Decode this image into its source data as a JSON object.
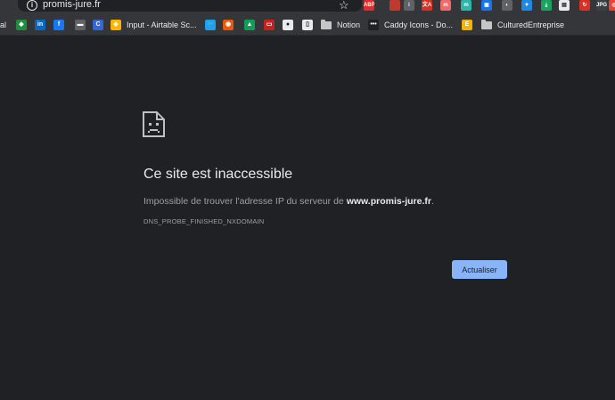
{
  "toolbar": {
    "url": "promis-jure.fr",
    "info_glyph": "i",
    "star_glyph": "☆",
    "extensions": [
      {
        "name": "adblock-plus-icon",
        "glyph": "ABP",
        "color": "#e32b2b"
      },
      {
        "name": "pen-tool-icon",
        "glyph": "",
        "color": "#c0392b"
      },
      {
        "name": "info-icon",
        "glyph": "i",
        "color": "#5f6368"
      },
      {
        "name": "translate-icon",
        "glyph": "文A",
        "color": "#d93025"
      },
      {
        "name": "mm-icon",
        "glyph": "m",
        "color": "#f06a6a"
      },
      {
        "name": "m-icon",
        "glyph": "m",
        "color": "#2bb8a8"
      },
      {
        "name": "window-icon",
        "glyph": "▣",
        "color": "#1a73e8"
      },
      {
        "name": "circle-icon",
        "glyph": "◐",
        "color": "#5f6368"
      },
      {
        "name": "feather-icon",
        "glyph": "✦",
        "color": "#1e88e5"
      },
      {
        "name": "pin-icon",
        "glyph": "⤓",
        "color": "#1aa260"
      },
      {
        "name": "page-icon",
        "glyph": "▤",
        "color": "#e8eaed"
      },
      {
        "name": "red-circle-icon",
        "glyph": "↻",
        "color": "#d93025"
      },
      {
        "name": "jpg-icon",
        "glyph": "JPG",
        "color": "#3c4043"
      },
      {
        "name": "target-icon",
        "glyph": "◎",
        "color": "#ea4335"
      }
    ]
  },
  "bookmarks": [
    {
      "name": "bookmark-al",
      "icon": "",
      "color": "#35363a",
      "label": "al"
    },
    {
      "name": "bookmark-green-diamond",
      "icon": "◆",
      "color": "#1e8e3e",
      "label": ""
    },
    {
      "name": "bookmark-linkedin",
      "icon": "in",
      "color": "#0a66c2",
      "label": ""
    },
    {
      "name": "bookmark-facebook",
      "icon": "f",
      "color": "#1877f2",
      "label": ""
    },
    {
      "name": "bookmark-monitor",
      "icon": "▬",
      "color": "#5f6368",
      "label": ""
    },
    {
      "name": "bookmark-c-circle",
      "icon": "C",
      "color": "#3367d6",
      "label": ""
    },
    {
      "name": "bookmark-airtable",
      "icon": "◈",
      "color": "#fcb400",
      "label": "Input - Airtable Sc..."
    },
    {
      "name": "bookmark-twitter",
      "icon": "🐦",
      "color": "#1da1f2",
      "label": ""
    },
    {
      "name": "bookmark-orange-circle",
      "icon": "◉",
      "color": "#e8590c",
      "label": ""
    },
    {
      "name": "bookmark-drive",
      "icon": "▲",
      "color": "#0f9d58",
      "label": ""
    },
    {
      "name": "bookmark-red-bar",
      "icon": "▭",
      "color": "#c5221f",
      "label": ""
    },
    {
      "name": "bookmark-github",
      "icon": "●",
      "color": "#e8eaed",
      "label": ""
    },
    {
      "name": "bookmark-doc",
      "icon": "▯",
      "color": "#e8eaed",
      "label": ""
    },
    {
      "name": "bookmark-notion",
      "icon": "",
      "color": "",
      "label": "Notion"
    },
    {
      "name": "bookmark-caddy",
      "icon": "•••",
      "color": "#202124",
      "label": "Caddy Icons - Do..."
    },
    {
      "name": "bookmark-e",
      "icon": "E",
      "color": "#f4b400",
      "label": ""
    },
    {
      "name": "bookmark-cultured",
      "icon": "",
      "color": "",
      "label": "CulturedEntreprise"
    }
  ],
  "error": {
    "title": "Ce site est inaccessible",
    "message_prefix": "Impossible de trouver l'adresse IP du serveur de ",
    "host": "www.promis-jure.fr",
    "message_suffix": ".",
    "code": "DNS_PROBE_FINISHED_NXDOMAIN",
    "reload_label": "Actualiser"
  }
}
